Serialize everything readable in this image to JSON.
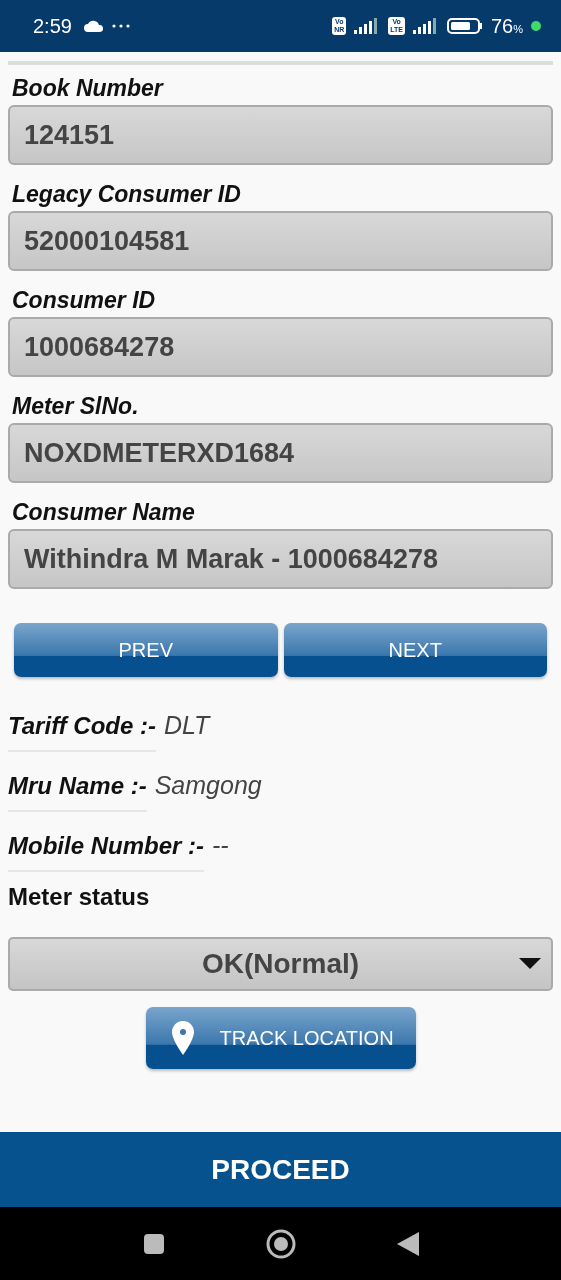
{
  "status_bar": {
    "time": "2:59",
    "sim1": {
      "top": "Vo",
      "bottom": "NR"
    },
    "sim2": {
      "top": "Vo",
      "bottom": "LTE"
    },
    "battery": "76",
    "battery_unit": "%"
  },
  "fields": [
    {
      "label": "Book Number",
      "value": "124151"
    },
    {
      "label": "Legacy Consumer ID",
      "value": "52000104581"
    },
    {
      "label": "Consumer ID",
      "value": "1000684278"
    },
    {
      "label": "Meter SlNo.",
      "value": "NOXDMETERXD1684"
    },
    {
      "label": "Consumer Name",
      "value": "Withindra M Marak - 1000684278"
    }
  ],
  "nav_buttons": [
    "PREV",
    "NEXT"
  ],
  "info": [
    {
      "label": "Tariff Code :-",
      "value": "DLT"
    },
    {
      "label": "Mru Name :-",
      "value": "Samgong"
    },
    {
      "label": "Mobile Number :-",
      "value": "--"
    }
  ],
  "meter_status": {
    "label": "Meter status",
    "value": "OK(Normal)"
  },
  "track_button": "TRACK LOCATION",
  "proceed_button": "PROCEED"
}
